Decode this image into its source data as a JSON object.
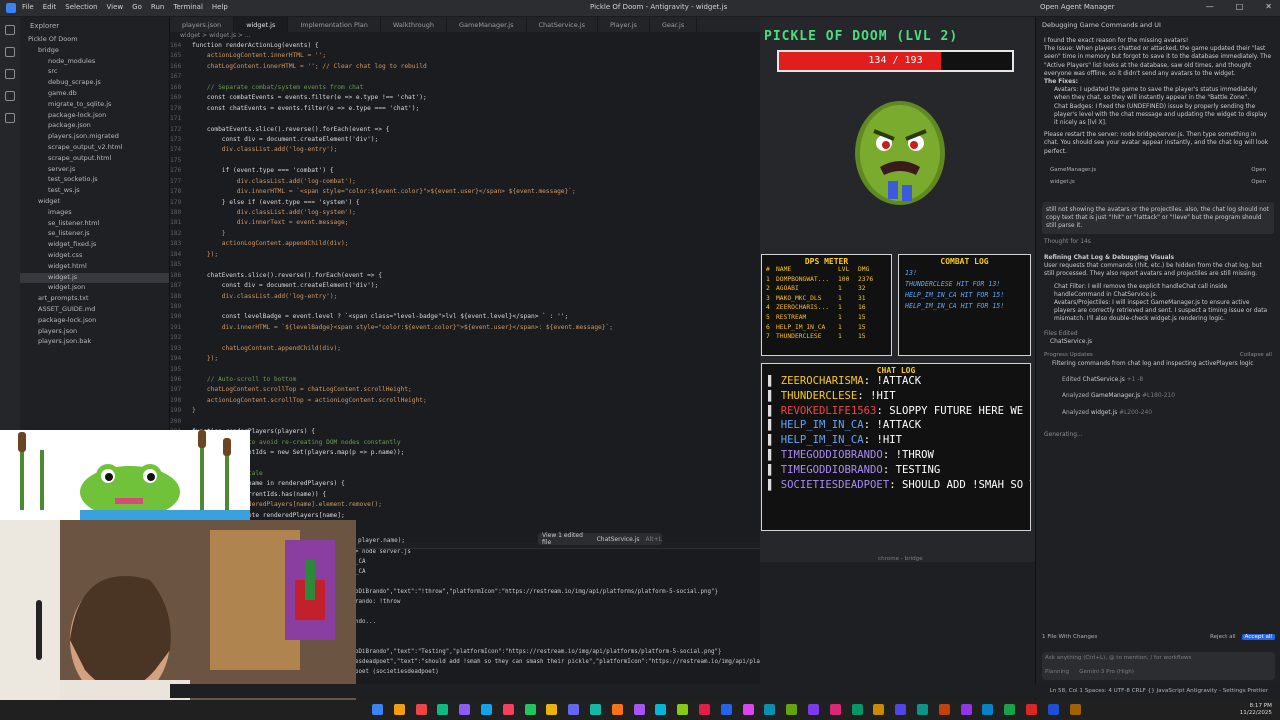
{
  "titlebar": {
    "menu": [
      "File",
      "Edit",
      "Selection",
      "View",
      "Go",
      "Run",
      "Terminal",
      "Help"
    ],
    "title": "Pickle Of Doom - Antigravity - widget.js",
    "account": "Open Agent Manager"
  },
  "explorer": {
    "header": "Explorer",
    "items": [
      {
        "label": "Pickle Of Doom",
        "indent": 0
      },
      {
        "label": "bridge",
        "indent": 1
      },
      {
        "label": "node_modules",
        "indent": 2
      },
      {
        "label": "src",
        "indent": 2
      },
      {
        "label": "debug_scrape.js",
        "indent": 2
      },
      {
        "label": "game.db",
        "indent": 2
      },
      {
        "label": "migrate_to_sqlite.js",
        "indent": 2
      },
      {
        "label": "package-lock.json",
        "indent": 2
      },
      {
        "label": "package.json",
        "indent": 2
      },
      {
        "label": "players.json.migrated",
        "indent": 2
      },
      {
        "label": "scrape_output_v2.html",
        "indent": 2
      },
      {
        "label": "scrape_output.html",
        "indent": 2
      },
      {
        "label": "server.js",
        "indent": 2
      },
      {
        "label": "test_socketio.js",
        "indent": 2
      },
      {
        "label": "test_ws.js",
        "indent": 2
      },
      {
        "label": "widget",
        "indent": 1
      },
      {
        "label": "images",
        "indent": 2
      },
      {
        "label": "se_listener.html",
        "indent": 2
      },
      {
        "label": "se_listener.js",
        "indent": 2
      },
      {
        "label": "widget_fixed.js",
        "indent": 2
      },
      {
        "label": "widget.css",
        "indent": 2
      },
      {
        "label": "widget.html",
        "indent": 2
      },
      {
        "label": "widget.js",
        "indent": 2,
        "selected": true
      },
      {
        "label": "widget.json",
        "indent": 2
      },
      {
        "label": "art_prompts.txt",
        "indent": 1
      },
      {
        "label": "ASSET_GUIDE.md",
        "indent": 1
      },
      {
        "label": "package-lock.json",
        "indent": 1
      },
      {
        "label": "players.json",
        "indent": 1
      },
      {
        "label": "players.json.bak",
        "indent": 1
      }
    ]
  },
  "tabs": [
    "players.json",
    "widget.js",
    "Implementation Plan",
    "Walkthrough",
    "GameManager.js",
    "ChatService.js",
    "Player.js",
    "Gear.js"
  ],
  "breadcrumb": "widget > widget.js > ...",
  "code": [
    {
      "n": "164",
      "t": "function renderActionLog(events) {"
    },
    {
      "n": "165",
      "t": "    actionLogContent.innerHTML = '';"
    },
    {
      "n": "166",
      "t": "    chatLogContent.innerHTML = ''; // Clear chat log to rebuild"
    },
    {
      "n": "167",
      "t": ""
    },
    {
      "n": "168",
      "t": "    // Separate combat/system events from chat"
    },
    {
      "n": "169",
      "t": "    const combatEvents = events.filter(e => e.type !== 'chat');"
    },
    {
      "n": "170",
      "t": "    const chatEvents = events.filter(e => e.type === 'chat');"
    },
    {
      "n": "171",
      "t": ""
    },
    {
      "n": "172",
      "t": "    combatEvents.slice().reverse().forEach(event => {"
    },
    {
      "n": "173",
      "t": "        const div = document.createElement('div');"
    },
    {
      "n": "174",
      "t": "        div.classList.add('log-entry');"
    },
    {
      "n": "175",
      "t": ""
    },
    {
      "n": "176",
      "t": "        if (event.type === 'combat') {"
    },
    {
      "n": "177",
      "t": "            div.classList.add('log-combat');"
    },
    {
      "n": "178",
      "t": "            div.innerHTML = `<span style=\"color:${event.color}\">${event.user}</span> ${event.message}`;"
    },
    {
      "n": "179",
      "t": "        } else if (event.type === 'system') {"
    },
    {
      "n": "180",
      "t": "            div.classList.add('log-system');"
    },
    {
      "n": "181",
      "t": "            div.innerText = event.message;"
    },
    {
      "n": "182",
      "t": "        }"
    },
    {
      "n": "183",
      "t": "        actionLogContent.appendChild(div);"
    },
    {
      "n": "184",
      "t": "    });"
    },
    {
      "n": "185",
      "t": ""
    },
    {
      "n": "186",
      "t": "    chatEvents.slice().reverse().forEach(event => {"
    },
    {
      "n": "187",
      "t": "        const div = document.createElement('div');"
    },
    {
      "n": "188",
      "t": "        div.classList.add('log-entry');"
    },
    {
      "n": "189",
      "t": ""
    },
    {
      "n": "190",
      "t": "        const levelBadge = event.level ? `<span class=\"level-badge\">lvl ${event.level}</span> ` : '';"
    },
    {
      "n": "191",
      "t": "        div.innerHTML = `${levelBadge}<span style=\"color:${event.color}\">${event.user}</span>: ${event.message}`;"
    },
    {
      "n": "192",
      "t": ""
    },
    {
      "n": "193",
      "t": "        chatLogContent.appendChild(div);"
    },
    {
      "n": "194",
      "t": "    });"
    },
    {
      "n": "195",
      "t": ""
    },
    {
      "n": "196",
      "t": "    // Auto-scroll to bottom"
    },
    {
      "n": "197",
      "t": "    chatLogContent.scrollTop = chatLogContent.scrollHeight;"
    },
    {
      "n": "198",
      "t": "    actionLogContent.scrollTop = actionLogContent.scrollHeight;"
    },
    {
      "n": "199",
      "t": "}"
    },
    {
      "n": "200",
      "t": ""
    },
    {
      "n": "201",
      "t": "function renderPlayers(players) {"
    },
    {
      "n": "202",
      "t": "    // Diffing to avoid re-creating DOM nodes constantly"
    },
    {
      "n": "203",
      "t": "    const currentIds = new Set(players.map(p => p.name));"
    },
    {
      "n": "204",
      "t": ""
    },
    {
      "n": "205",
      "t": "    // Remove stale"
    },
    {
      "n": "206",
      "t": "    for (const name in renderedPlayers) {"
    },
    {
      "n": "207",
      "t": "        if (!currentIds.has(name)) {"
    },
    {
      "n": "208",
      "t": "            renderedPlayers[name].element.remove();"
    },
    {
      "n": "209",
      "t": "            delete renderedPlayers[name];"
    }
  ],
  "edit_pill": {
    "label": "View 1 edited file",
    "file": "ChatService.js",
    "shortcut": "Alt+L"
  },
  "code_fragment": "player.name);",
  "terminal": [
    "> node server.js",
    "_CA",
    "_CA",
    "",
    "oDiBrando\",\"text\":\"!throw\",\"platformIcon\":\"https://restream.io/img/api/platforms/platform-5-social.png\"}",
    "rando: !throw",
    "",
    "ndo...",
    "",
    "",
    "oDiBrando\",\"text\":\"Testing\",\"platformIcon\":\"https://restream.io/img/api/platforms/platform-5-social.png\"}",
    "esdeadpoet\",\"text\":\"should add !smah so they can smash their pickle\",\"platformIcon\":\"https://restream.io/img/api/platforms/platform-5-social.png\"}",
    "poet (societiesdeadpoet)"
  ],
  "game": {
    "title": "PICKLE OF DOOM (LVL 2)",
    "hp_text": "134 / 193",
    "hp_current": 134,
    "hp_max": 193,
    "hp_color": "#e11d1d",
    "dps": {
      "title": "DPS METER",
      "headers": [
        "#",
        "NAME",
        "LVL",
        "DMG"
      ],
      "rows": [
        [
          "1",
          "DOMPBONGWAT...",
          "100",
          "2376"
        ],
        [
          "2",
          "AGOABI",
          "1",
          "32"
        ],
        [
          "3",
          "MAKO_MKC_DLS",
          "1",
          "31"
        ],
        [
          "4",
          "ZEEROCHARIS...",
          "1",
          "16"
        ],
        [
          "5",
          "RESTREAM",
          "1",
          "15"
        ],
        [
          "6",
          "HELP_IM_IN_CA",
          "1",
          "15"
        ],
        [
          "7",
          "THUNDERCLESE",
          "1",
          "15"
        ]
      ]
    },
    "combat": {
      "title": "COMBAT LOG",
      "entries": [
        "13!",
        "THUNDERCLESE HIT FOR 13!",
        "HELP_IM_IN_CA HIT FOR 15!",
        "HELP_IM_IN_CA HIT FOR 15!"
      ]
    },
    "chat": {
      "title": "CHAT LOG",
      "entries": [
        {
          "user": "ZEEROCHARISMA",
          "msg": "!ATTACK",
          "color": "#facc15"
        },
        {
          "user": "THUNDERCLESE",
          "msg": "!HIT",
          "color": "#facc15"
        },
        {
          "user": "REVOKEDLIFE1563",
          "msg": "SLOPPY FUTURE HERE WE COME.",
          "color": "#ef4444"
        },
        {
          "user": "HELP_IM_IN_CA",
          "msg": "!ATTACK",
          "color": "#60a5fa"
        },
        {
          "user": "HELP_IM_IN_CA",
          "msg": "!HIT",
          "color": "#60a5fa"
        },
        {
          "user": "TIMEGODDIOBRANDO",
          "msg": "!THROW",
          "color": "#a78bfa"
        },
        {
          "user": "TIMEGODDIOBRANDO",
          "msg": "TESTING",
          "color": "#a78bfa"
        },
        {
          "user": "SOCIETIESDEADPOET",
          "msg": "SHOULD ADD !SMAH SO THEY CAN SMASH THEIR PICKLE",
          "color": "#a78bfa"
        }
      ]
    },
    "browser_bar": "chrome - bridge"
  },
  "agent": {
    "header": "Debugging Game Commands and UI",
    "para1": "I found the exact reason for the missing avatars!",
    "para2": "The Issue: When players chatted or attacked, the game updated their \"last seen\" time in memory but forgot to save it to the database immediately. The \"Active Players\" list looks at the database, saw old times, and thought everyone was offline, so it didn't send any avatars to the widget.",
    "fixes_label": "The Fixes:",
    "fix1": "Avatars: I updated the game to save the player's status immediately when they chat, so they will instantly appear in the \"Battle Zone\".",
    "fix2": "Chat Badges: I fixed the (UNDEFINED) issue by properly sending the player's level with the chat message and updating the widget to display it nicely as [lvl X].",
    "para3": "Please restart the server: node bridge/server.js. Then type something in chat. You should see your avatar appear instantly, and the chat log will look perfect.",
    "chips": [
      {
        "file": "GameManager.js",
        "action": "Open"
      },
      {
        "file": "widget.js",
        "action": "Open"
      }
    ],
    "user_msg": "still not showing the avatars or the projectiles. also, the chat log should not copy text that is just \"!hit\" or \"!attack\" or \"!leve\" but the program should still parse it.",
    "thought": "Thought for 14s",
    "task_title": "Refining Chat Log & Debugging Visuals",
    "task_desc": "User requests that commands (!hit, etc.) be hidden from the chat log, but still processed. They also report avatars and projectiles are still missing.",
    "bullet1": "Chat Filter: I will remove the explicit handleChat call inside handleCommand in ChatService.js.",
    "bullet2": "Avatars/Projectiles: I will inspect GameManager.js to ensure active players are correctly retrieved and sent. I suspect a timing issue or data mismatch. I'll also double-check widget.js rendering logic.",
    "files_edited": "Files Edited",
    "edited_file": "ChatService.js",
    "progress": "Progress Updates",
    "collapse": "Collapse all",
    "progress_item": "Filtering commands from chat log and inspecting activePlayers logic",
    "steps": [
      {
        "verb": "Edited",
        "file": "ChatService.js",
        "range": "+1 -8"
      },
      {
        "verb": "Analyzed",
        "file": "GameManager.js",
        "range": "#L180-210"
      },
      {
        "verb": "Analyzed",
        "file": "widget.js",
        "range": "#L200-240"
      }
    ],
    "generating": "Generating...",
    "changes": "1 File With Changes",
    "reject": "Reject all",
    "accept": "Accept all",
    "input_placeholder": "Ask anything (Ctrl+L), @ to mention, / for workflows",
    "mode": "Planning",
    "model": "Gemini 3 Pro (High)"
  },
  "statusbar": "Ln 58, Col 1   Spaces: 4   UTF-8   CRLF   {} JavaScript   Antigravity - Settings   Prettier",
  "taskbar": {
    "time": "8:17 PM",
    "date": "11/22/2025"
  }
}
